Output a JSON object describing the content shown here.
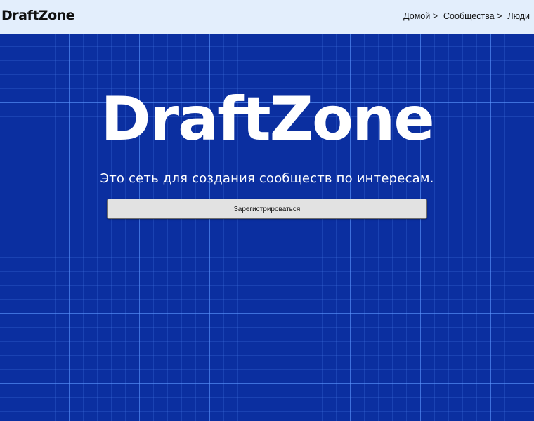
{
  "header": {
    "logo": "DraftZone",
    "nav": [
      {
        "label": "Домой >"
      },
      {
        "label": "Сообщества >"
      },
      {
        "label": "Люди"
      }
    ]
  },
  "hero": {
    "title": "DraftZone",
    "subtitle": "Это сеть для создания сообществ по интересам.",
    "register_label": "Зарегистрироваться"
  },
  "colors": {
    "header_bg": "#e3eefc",
    "hero_bg": "#0b2fa0",
    "grid_line": "#5a96ff",
    "button_bg": "#e2e2e2"
  }
}
